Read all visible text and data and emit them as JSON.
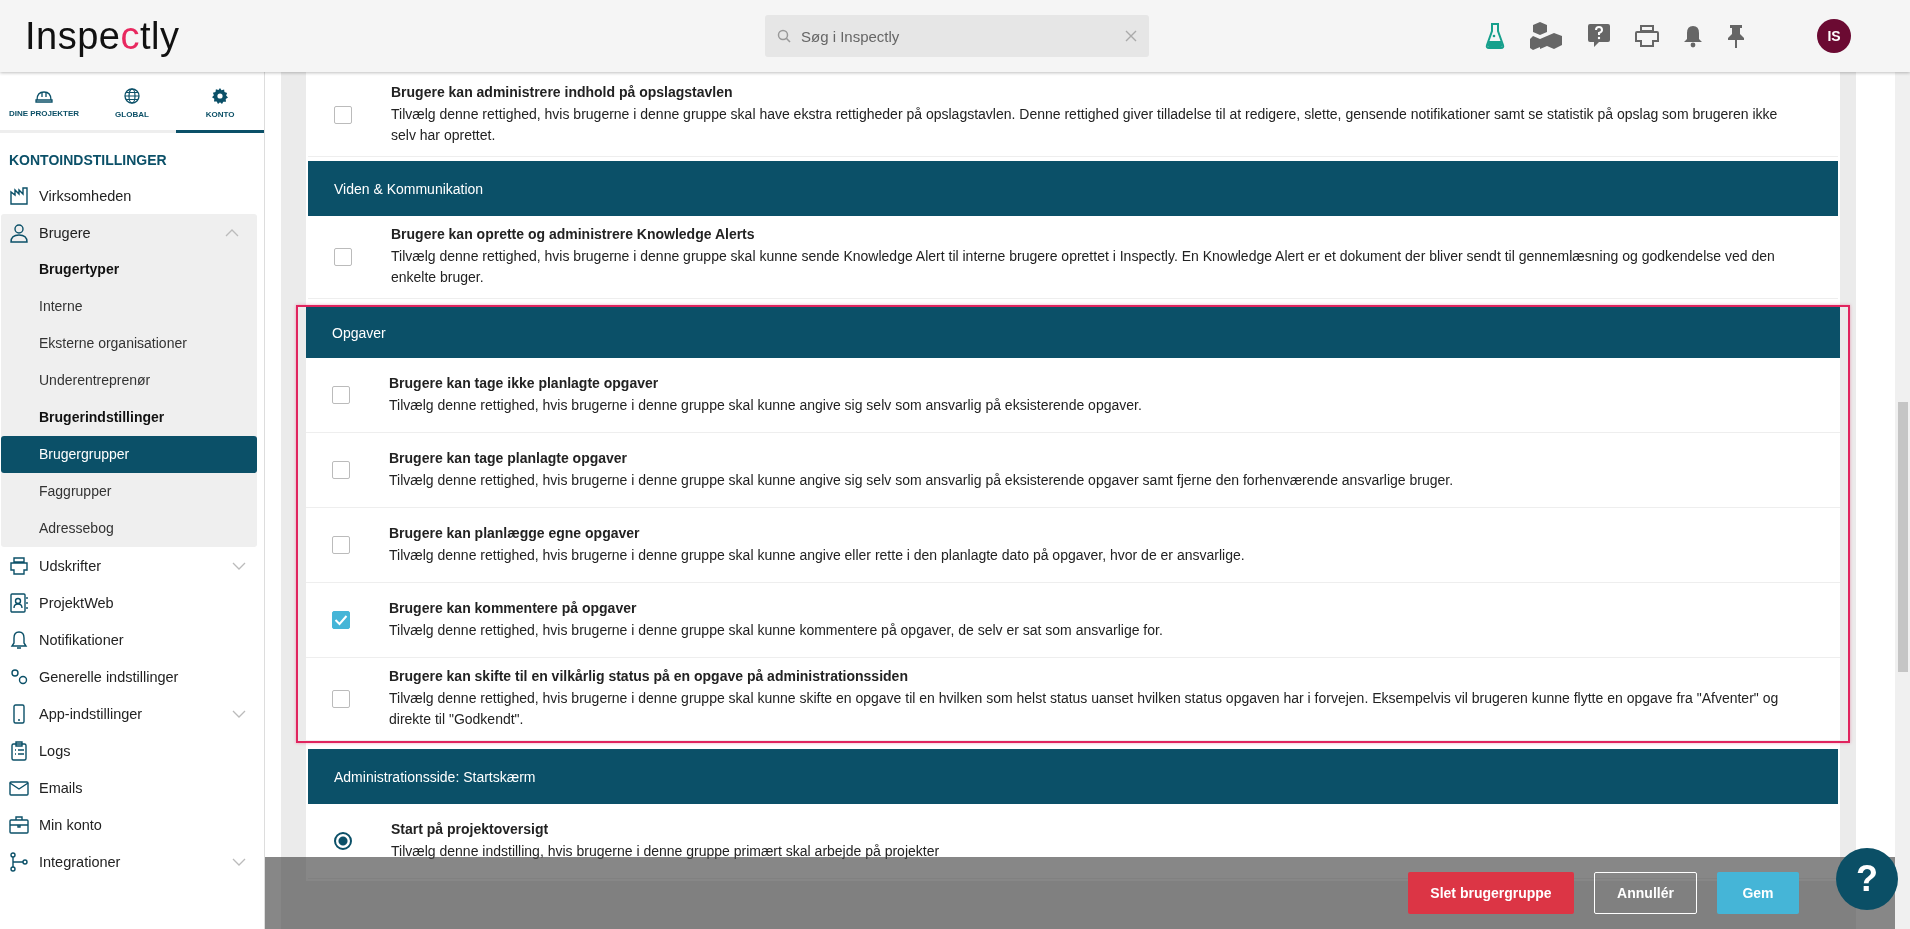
{
  "header": {
    "logo": {
      "before": "Inspe",
      "accent": "c",
      "after": "tly"
    },
    "search": {
      "placeholder": "Søg i Inspectly"
    },
    "avatar": "IS"
  },
  "sidebar": {
    "tabs": [
      {
        "label": "DINE PROJEKTER",
        "selected": false
      },
      {
        "label": "GLOBAL",
        "selected": false
      },
      {
        "label": "KONTO",
        "selected": true
      }
    ],
    "heading": "KONTOINDSTILLINGER",
    "items": [
      {
        "label": "Virksomheden"
      },
      {
        "label": "Brugere",
        "expanded": true,
        "children": [
          {
            "label": "Brugertyper",
            "kind": "heading",
            "selected": false
          },
          {
            "label": "Interne",
            "kind": "link",
            "selected": false
          },
          {
            "label": "Eksterne organisationer",
            "kind": "link",
            "selected": false
          },
          {
            "label": "Underentreprenør",
            "kind": "link",
            "selected": false
          },
          {
            "label": "Brugerindstillinger",
            "kind": "heading",
            "selected": false
          },
          {
            "label": "Brugergrupper",
            "kind": "link",
            "selected": true
          },
          {
            "label": "Faggrupper",
            "kind": "link",
            "selected": false
          },
          {
            "label": "Adressebog",
            "kind": "link",
            "selected": false
          }
        ]
      },
      {
        "label": "Udskrifter",
        "expanded": false
      },
      {
        "label": "ProjektWeb"
      },
      {
        "label": "Notifikationer"
      },
      {
        "label": "Generelle indstillinger"
      },
      {
        "label": "App-indstillinger",
        "expanded": false
      },
      {
        "label": "Logs"
      },
      {
        "label": "Emails"
      },
      {
        "label": "Min konto"
      },
      {
        "label": "Integrationer",
        "expanded": false
      }
    ]
  },
  "sections": [
    {
      "highlighted": false,
      "rows": [
        {
          "kind": "checkbox",
          "checked": false,
          "title": "Brugere kan administrere indhold på opslagstavlen",
          "description": "Tilvælg denne rettighed, hvis brugerne i denne gruppe skal have ekstra rettigheder på opslagstavlen. Denne rettighed giver tilladelse til at redigere, slette, gensende notifikationer samt se statistik på opslag som brugeren ikke selv har oprettet."
        }
      ]
    },
    {
      "title": "Viden & Kommunikation",
      "highlighted": false,
      "rows": [
        {
          "kind": "checkbox",
          "checked": false,
          "title": "Brugere kan oprette og administrere Knowledge Alerts",
          "description": "Tilvælg denne rettighed, hvis brugerne i denne gruppe skal kunne sende Knowledge Alert til interne brugere oprettet i Inspectly. En Knowledge Alert er et dokument der bliver sendt til gennemlæsning og godkendelse ved den enkelte bruger."
        }
      ]
    },
    {
      "title": "Opgaver",
      "highlighted": true,
      "rows": [
        {
          "kind": "checkbox",
          "checked": false,
          "title": "Brugere kan tage ikke planlagte opgaver",
          "description": "Tilvælg denne rettighed, hvis brugerne i denne gruppe skal kunne angive sig selv som ansvarlig på eksisterende opgaver."
        },
        {
          "kind": "checkbox",
          "checked": false,
          "title": "Brugere kan tage planlagte opgaver",
          "description": "Tilvælg denne rettighed, hvis brugerne i denne gruppe skal kunne angive sig selv som ansvarlig på eksisterende opgaver samt fjerne den forhenværende ansvarlige bruger."
        },
        {
          "kind": "checkbox",
          "checked": false,
          "title": "Brugere kan planlægge egne opgaver",
          "description": "Tilvælg denne rettighed, hvis brugerne i denne gruppe skal kunne angive eller rette i den planlagte dato på opgaver, hvor de er ansvarlige."
        },
        {
          "kind": "checkbox",
          "checked": true,
          "title": "Brugere kan kommentere på opgaver",
          "description": "Tilvælg denne rettighed, hvis brugerne i denne gruppe skal kunne kommentere på opgaver, de selv er sat som ansvarlige for."
        },
        {
          "kind": "checkbox",
          "checked": false,
          "title": "Brugere kan skifte til en vilkårlig status på en opgave på administrationssiden",
          "description": "Tilvælg denne rettighed, hvis brugerne i denne gruppe skal kunne skifte en opgave til en hvilken som helst status uanset hvilken status opgaven har i forvejen. Eksempelvis vil brugeren kunne flytte en opgave fra \"Afventer\" og direkte til \"Godkendt\"."
        }
      ]
    },
    {
      "title": "Administrationsside: Startskærm",
      "highlighted": false,
      "rows": [
        {
          "kind": "radio",
          "checked": true,
          "title": "Start på projektoversigt",
          "description": "Tilvælg denne indstilling, hvis brugerne i denne gruppe primært skal arbejde på projekter"
        }
      ]
    }
  ],
  "actions": {
    "buttons": [
      {
        "label": "Slet brugergruppe",
        "kind": "danger"
      },
      {
        "label": "Annullér",
        "kind": "outline"
      },
      {
        "label": "Gem",
        "kind": "primary"
      }
    ],
    "help": "?"
  }
}
